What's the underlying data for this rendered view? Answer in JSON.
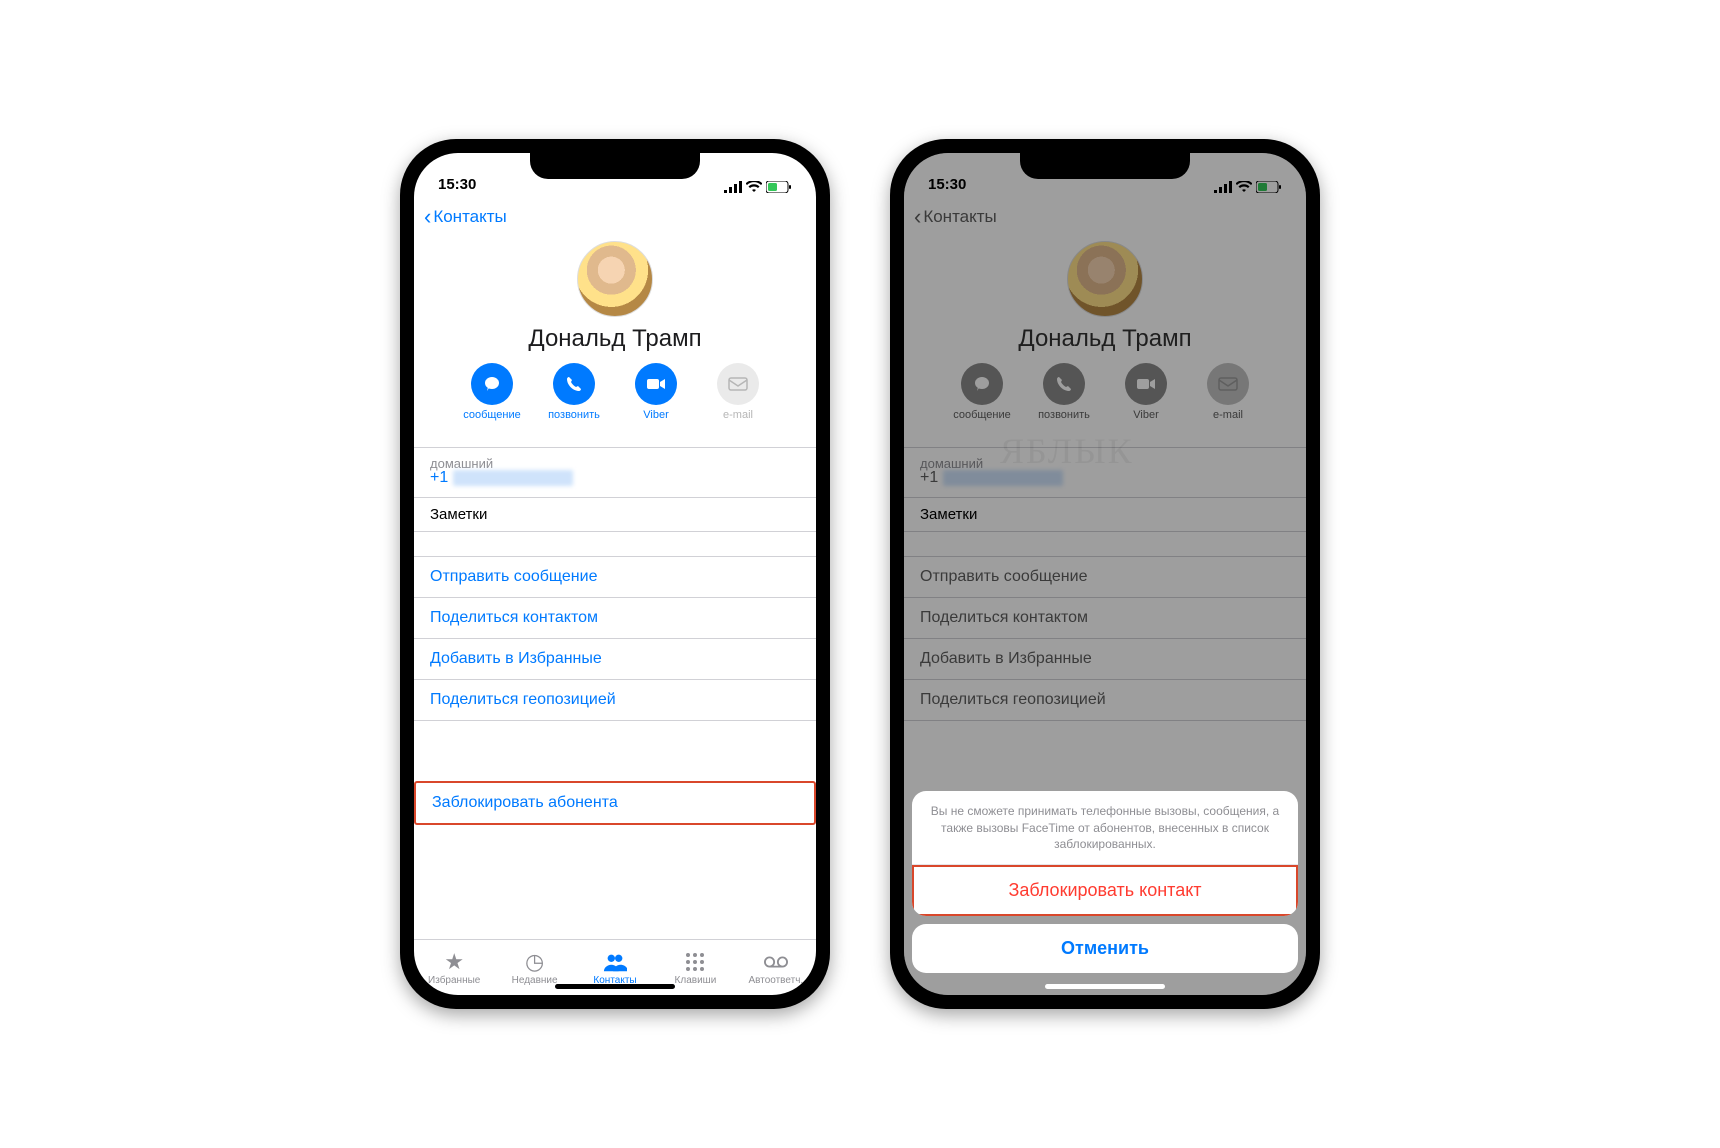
{
  "status": {
    "time": "15:30"
  },
  "nav": {
    "back": "Контакты"
  },
  "contact": {
    "name": "Дональд Трамп",
    "actions": [
      {
        "label": "сообщение",
        "icon": "message",
        "enabled": true
      },
      {
        "label": "позвонить",
        "icon": "phone",
        "enabled": true
      },
      {
        "label": "Viber",
        "icon": "video",
        "enabled": true
      },
      {
        "label": "e-mail",
        "icon": "mail",
        "enabled": false
      }
    ],
    "phone_label": "домашний",
    "phone_prefix": "+1",
    "notes_label": "Заметки"
  },
  "links": {
    "send_message": "Отправить сообщение",
    "share_contact": "Поделиться контактом",
    "add_favorites": "Добавить в Избранные",
    "share_location": "Поделиться геопозицией",
    "block": "Заблокировать абонента"
  },
  "tabs": [
    {
      "label": "Избранные",
      "icon": "★"
    },
    {
      "label": "Недавние",
      "icon": "◔"
    },
    {
      "label": "Контакты",
      "icon": "👥",
      "active": true
    },
    {
      "label": "Клавиши",
      "icon": "⠿"
    },
    {
      "label": "Автоответч.",
      "icon": "◯◯"
    }
  ],
  "sheet": {
    "message": "Вы не сможете принимать телефонные вызовы, сообщения, а также вызовы FaceTime от абонентов, внесенных в список заблокированных.",
    "action": "Заблокировать контакт",
    "cancel": "Отменить"
  },
  "watermark": "ЯБЛЫК"
}
